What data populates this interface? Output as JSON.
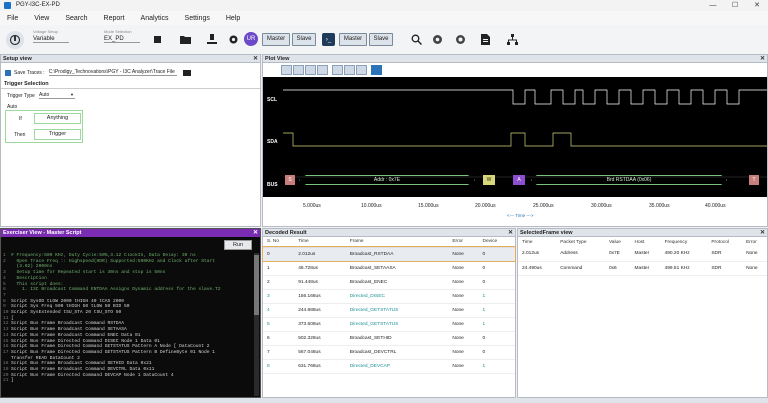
{
  "app": {
    "title": "PGY-I3C-EX-PD",
    "window_controls": [
      "—",
      "☐",
      "✕"
    ]
  },
  "menu": [
    "File",
    "View",
    "Search",
    "Report",
    "Analytics",
    "Settings",
    "Help"
  ],
  "toolbar": {
    "voltage_label": "Voltage Setup",
    "voltage_value": "Variable",
    "mode_label": "Mode Selection",
    "mode_value": "EX_PD",
    "master_label": "Master",
    "slave_label": "Slave",
    "user_initials": "UR"
  },
  "setup": {
    "title": "Setup view",
    "save_traces_label": "Save Traces :",
    "save_traces_path": "C:\\Prodigy_Technovations\\PGY - I3C Analyzer\\Trace File",
    "trigger_title": "Trigger Selection",
    "trigger_type_label": "Trigger Type",
    "trigger_type_value": "Auto",
    "auto_label": "Auto",
    "if_label": "If",
    "if_value": "Anything",
    "then_label": "Then",
    "then_value": "Trigger"
  },
  "plot": {
    "title": "Plot View",
    "signals": [
      "SCL",
      "SDA",
      "BUS"
    ],
    "bus_labels": [
      "S",
      "Addr : 0x7E",
      "W",
      "A",
      "Brd RSTDAA (0x06)",
      "T"
    ],
    "time_ticks": [
      "5.000us",
      "10.000us",
      "15.000us",
      "20.000us",
      "25.000us",
      "30.000us",
      "35.000us",
      "40.000us"
    ],
    "time_axis_label": "<--- Time --->"
  },
  "exerciser": {
    "title": "Exerciser View - Master Script",
    "run_label": "Run",
    "lines": [
      {
        "n": "1",
        "t": "# Frequency:500 KHz, Duty Cycle:50%,3.12 ClockIn, Data Delay: 30 ns",
        "c": "#6fb16f"
      },
      {
        "n": "2",
        "t": "  Open Trace Freq :: Highspeed(HDR) Supported:500KHz and Clock after Start",
        "c": "#6fb16f"
      },
      {
        "n": "",
        "t": "  (3.02) 2000ns",
        "c": "#6fb16f"
      },
      {
        "n": "3",
        "t": "  Setup time for Repeated start is 30ns and stop is 50ns",
        "c": "#6fb16f"
      },
      {
        "n": "4",
        "t": "  Description",
        "c": "#6fb16f"
      },
      {
        "n": "5",
        "t": "  This script does:",
        "c": "#6fb16f"
      },
      {
        "n": "6",
        "t": "    1. I3C Broadcast Command ENTDAA Assigns Dynamic address for the slave.T2",
        "c": "#6fb16f"
      },
      {
        "n": "7",
        "t": "",
        "c": "#d6d6d6"
      },
      {
        "n": "8",
        "t": "Script SysOD tLOW 2000 tHIGH 40 tCAS 2000",
        "c": "#d6d6d6"
      },
      {
        "n": "9",
        "t": "Script Sys Freq 500 tHIGH 50 tLOW 50 BID 50",
        "c": "#d6d6d6"
      },
      {
        "n": "10",
        "t": "Script SysExtended tSU_STA 20 tSU_STO 50",
        "c": "#d6d6d6"
      },
      {
        "n": "11",
        "t": "[",
        "c": "#d6d6d6"
      },
      {
        "n": "12",
        "t": "Script Bus Frame Broadcast Command RSTDAA",
        "c": "#d6d6d6"
      },
      {
        "n": "13",
        "t": "Script Bus Frame Broadcast Command SETAASA",
        "c": "#d6d6d6"
      },
      {
        "n": "14",
        "t": "Script Bus Frame Broadcast Command ENEC Data 01",
        "c": "#d6d6d6"
      },
      {
        "n": "15",
        "t": "Script Bus Frame Directed Command DISEC Node 1 Data 01",
        "c": "#d6d6d6"
      },
      {
        "n": "16",
        "t": "Script Bus Frame Directed Command GETSTATUS Pattern A Node [ DataCount 2",
        "c": "#d6d6d6"
      },
      {
        "n": "17",
        "t": "Script Bus Frame Directed Command GETSTATUS Pattern B DefineByte 01 Node 1",
        "c": "#d6d6d6"
      },
      {
        "n": "",
        "t": "Transfer READ DataCount 2",
        "c": "#d6d6d6"
      },
      {
        "n": "18",
        "t": "Script Bus Frame Broadcast Command SETHID Data 0x21",
        "c": "#d6d6d6"
      },
      {
        "n": "19",
        "t": "Script Bus Frame Broadcast Command DEVCTRL Data 0x11",
        "c": "#d6d6d6"
      },
      {
        "n": "20",
        "t": "Script Bus Frame Directed Command DEVCAP Node 1 DataCount 4",
        "c": "#d6d6d6"
      },
      {
        "n": "21",
        "t": "]",
        "c": "#d6d6d6"
      }
    ]
  },
  "decoded": {
    "title": "Decoded Result",
    "columns": [
      "S. No",
      "Time",
      "Frame",
      "Error",
      "Device"
    ],
    "rows": [
      {
        "no": "0",
        "time": "2.012us",
        "frame": "Broadcast_RSTDAA",
        "err": "None",
        "dev": "0",
        "cls": ""
      },
      {
        "no": "1",
        "time": "46.728us",
        "frame": "Broadcast_SETAASA",
        "err": "None",
        "dev": "0",
        "cls": ""
      },
      {
        "no": "2",
        "time": "91.448us",
        "frame": "Broadcast_ENEC",
        "err": "None",
        "dev": "0",
        "cls": ""
      },
      {
        "no": "3",
        "time": "156.168us",
        "frame": "Directed_DISEC",
        "err": "None",
        "dev": "1",
        "cls": "teal"
      },
      {
        "no": "4",
        "time": "244.888us",
        "frame": "Directed_GETSTATUS",
        "err": "None",
        "dev": "1",
        "cls": "teal"
      },
      {
        "no": "5",
        "time": "373.608us",
        "frame": "Directed_GETSTATUS",
        "err": "None",
        "dev": "1",
        "cls": "teal"
      },
      {
        "no": "6",
        "time": "502.328us",
        "frame": "Broadcast_SETHID",
        "err": "None",
        "dev": "0",
        "cls": ""
      },
      {
        "no": "7",
        "time": "567.048us",
        "frame": "Broadcast_DEVCTRL",
        "err": "None",
        "dev": "0",
        "cls": ""
      },
      {
        "no": "8",
        "time": "631.768us",
        "frame": "Directed_DEVCAP",
        "err": "None",
        "dev": "1",
        "cls": "teal"
      }
    ]
  },
  "selected": {
    "title": "SelectedFrame view",
    "columns": [
      "Time",
      "Packet Type",
      "Value",
      "Host",
      "Frequency",
      "Protocol",
      "Error"
    ],
    "rows": [
      {
        "time": "2.012us",
        "ptype": "Address",
        "val": "0x7E",
        "host": "Master",
        "freq": "490.20 KHz",
        "proto": "SDR",
        "err": "None"
      },
      {
        "time": "24.490us",
        "ptype": "Command",
        "val": "0x6",
        "host": "Master",
        "freq": "499.51 KHz",
        "proto": "SDR",
        "err": "None"
      }
    ]
  },
  "colors": {
    "accent": "#2c72b8",
    "scl": "#ffffff",
    "sda": "#d8d87a",
    "bus": "#7ac47a",
    "exerciser_header": "#7a2db3"
  }
}
